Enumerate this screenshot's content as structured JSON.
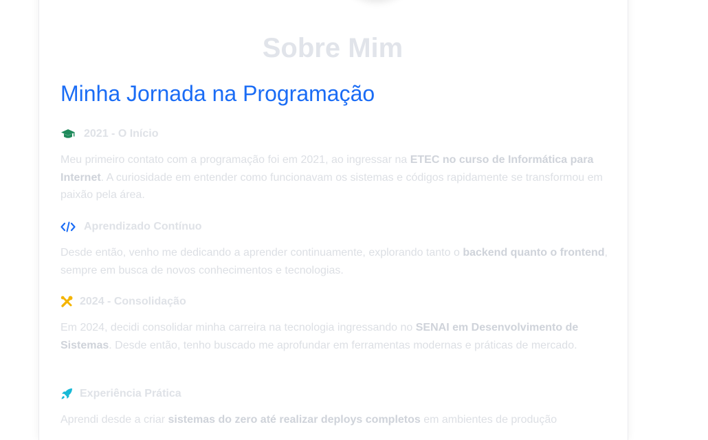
{
  "about": {
    "title": "Sobre Mim",
    "subtitle": "Minha Jornada na Programação"
  },
  "sections": [
    {
      "icon": "graduation-cap-icon",
      "icon_color": "#1f8a5b",
      "heading": "2021 - O Início",
      "text_before": "Meu primeiro contato com a programação foi em 2021, ao ingressar na ",
      "text_bold": "ETEC no curso de Informática para Internet",
      "text_after": ". A curiosidade em entender como funcionavam os sistemas e códigos rapidamente se transformou em paixão pela área."
    },
    {
      "icon": "code-icon",
      "icon_color": "#1a6cf5",
      "heading": "Aprendizado Contínuo",
      "text_before": "Desde então, venho me dedicando a aprender continuamente, explorando tanto o ",
      "text_bold": "backend quanto o frontend",
      "text_after": ", sempre em busca de novos conhecimentos e tecnologias."
    },
    {
      "icon": "tools-icon",
      "icon_color": "#f4b400",
      "heading": "2024 - Consolidação",
      "text_before": "Em 2024, decidi consolidar minha carreira na tecnologia ingressando no ",
      "text_bold": "SENAI em Desenvolvimento de Sistemas",
      "text_after": ". Desde então, tenho buscado me aprofundar em ferramentas modernas e práticas de mercado."
    },
    {
      "icon": "rocket-icon",
      "icon_color": "#17b9d6",
      "heading": "Experiência Prática",
      "text_before": "Aprendi desde a criar ",
      "text_bold": "sistemas do zero até realizar deploys completos",
      "text_after": " em ambientes de produção"
    }
  ]
}
